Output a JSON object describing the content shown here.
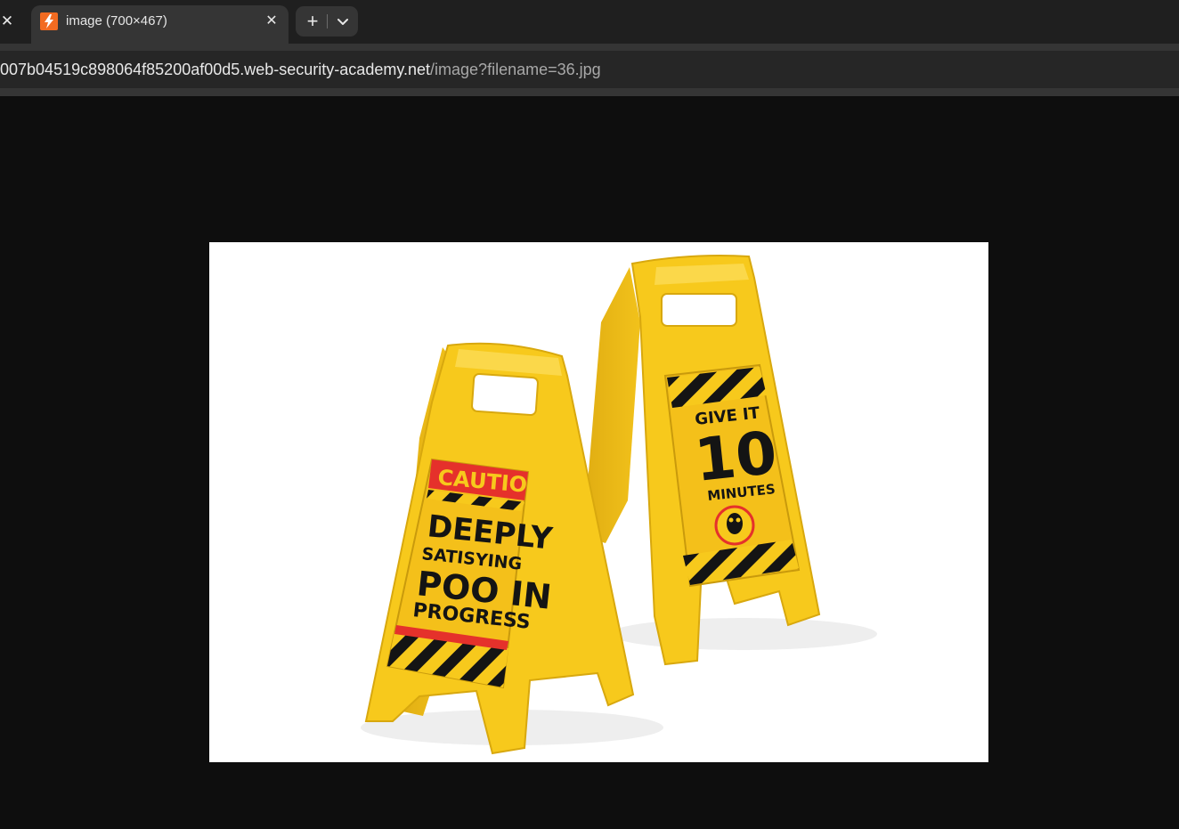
{
  "browser": {
    "tab": {
      "title": "image (700×467)",
      "favicon": "web-security-academy-logo-icon",
      "favicon_color": "#f26b21"
    },
    "icons": {
      "close": "✕",
      "new_tab": "+",
      "tab_search": "chevron-down-icon"
    },
    "address": {
      "host": "007b04519c898064f85200af00d5.web-security-academy.net",
      "path": "/image?filename=36.jpg"
    }
  },
  "image": {
    "description_labels": {
      "left_sign_header": "CAUTION",
      "left_sign_line1": "DEEPLY",
      "left_sign_line2": "SATISYING",
      "left_sign_line3": "POO IN",
      "left_sign_line4": "PROGRESS",
      "right_sign_line1": "GIVE IT",
      "right_sign_line2": "10",
      "right_sign_line3": "MINUTES"
    },
    "colors": {
      "sign_yellow": "#f7c91c",
      "caution_red": "#e5312b",
      "stripe_black": "#141414"
    }
  }
}
